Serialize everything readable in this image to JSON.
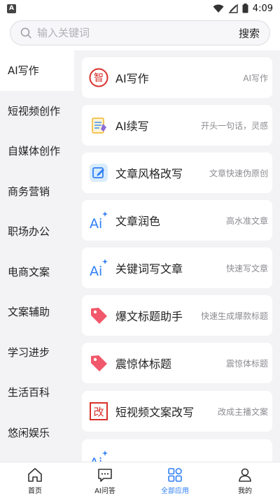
{
  "status_bar": {
    "notification": "A",
    "time": "4:09"
  },
  "search": {
    "placeholder": "输入关键词",
    "button_label": "搜索"
  },
  "sidebar": {
    "items": [
      {
        "label": "AI写作",
        "active": true
      },
      {
        "label": "短视频创作"
      },
      {
        "label": "自媒体创作"
      },
      {
        "label": "商务营销"
      },
      {
        "label": "职场办公"
      },
      {
        "label": "电商文案"
      },
      {
        "label": "文案辅助"
      },
      {
        "label": "学习进步"
      },
      {
        "label": "生活百科"
      },
      {
        "label": "悠闲娱乐"
      }
    ]
  },
  "cards": [
    {
      "title": "AI写作",
      "desc": "AI写作",
      "icon": "zhi-seal-icon"
    },
    {
      "title": "AI续写",
      "desc": "开头一句话，灵感",
      "icon": "notepad-icon"
    },
    {
      "title": "文章风格改写",
      "desc": "文章快速伪原创",
      "icon": "edit-square-icon"
    },
    {
      "title": "文章润色",
      "desc": "高水准文章",
      "icon": "ai-sparkle-icon"
    },
    {
      "title": "关键词写文章",
      "desc": "快速写文章",
      "icon": "ai-sparkle-icon"
    },
    {
      "title": "爆文标题助手",
      "desc": "快速生成爆款标题",
      "icon": "tag-icon"
    },
    {
      "title": "震惊体标题",
      "desc": "震惊体标题",
      "icon": "tag-icon"
    },
    {
      "title": "短视频文案改写",
      "desc": "改成主播文案",
      "icon": "gai-seal-icon"
    }
  ],
  "bottom_nav": {
    "items": [
      {
        "label": "首页",
        "icon": "home-icon"
      },
      {
        "label": "AI问答",
        "icon": "chat-icon"
      },
      {
        "label": "全部应用",
        "icon": "apps-icon",
        "active": true
      },
      {
        "label": "我的",
        "icon": "user-icon"
      }
    ]
  },
  "colors": {
    "accent": "#2f7ff5",
    "seal_red": "#d9302b",
    "tag_pink": "#f2586b"
  }
}
